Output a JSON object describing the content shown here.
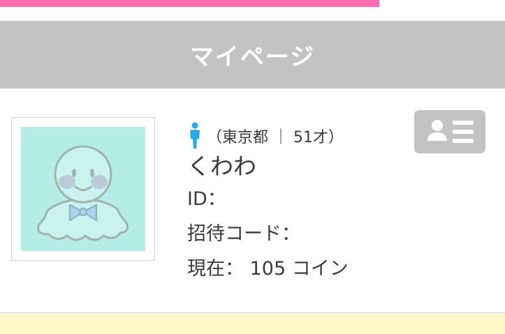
{
  "header": {
    "title": "マイページ"
  },
  "profile": {
    "location_age": "（東京都 ｜ 51才）",
    "name": "くわわ",
    "id_label": "ID：",
    "id_value": "",
    "invite_code_label": "招待コード：",
    "invite_code_value": "",
    "coins_label": "現在：",
    "coins_value": "105",
    "coins_unit": "コイン"
  },
  "icons": {
    "gender": "male-person-icon",
    "avatar": "teru-teru-bozu-avatar",
    "profile_card": "id-card-icon"
  },
  "colors": {
    "accent_pink": "#ff6eb0",
    "header_gray": "#c3c3c3",
    "avatar_bg": "#b4ece6",
    "gender_blue": "#2aa9e8",
    "yellow_section": "#fff8c8"
  }
}
